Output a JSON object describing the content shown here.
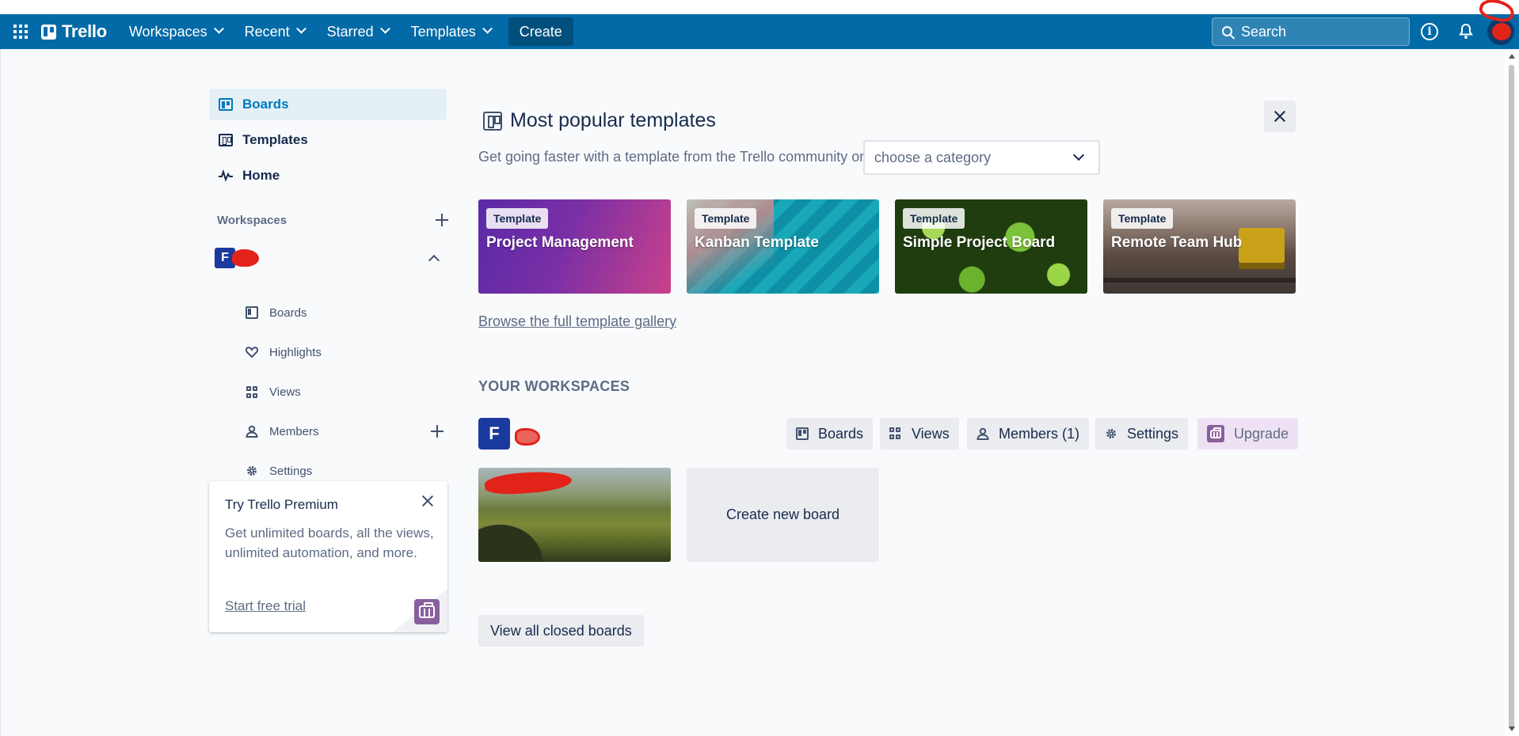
{
  "topbar": {
    "brand": "Trello",
    "nav": [
      {
        "label": "Workspaces"
      },
      {
        "label": "Recent"
      },
      {
        "label": "Starred"
      },
      {
        "label": "Templates"
      }
    ],
    "create_label": "Create",
    "search_placeholder": "Search",
    "info_glyph": "i",
    "accent": "#026aa7"
  },
  "sidebar": {
    "links": [
      {
        "label": "Boards",
        "icon": "board-icon",
        "active": true
      },
      {
        "label": "Templates",
        "icon": "template-icon"
      },
      {
        "label": "Home",
        "icon": "pulse-icon"
      }
    ],
    "workspaces_label": "Workspaces",
    "workspace_initial": "F",
    "sub_items": [
      {
        "label": "Boards",
        "icon": "board-icon"
      },
      {
        "label": "Highlights",
        "icon": "heart-icon"
      },
      {
        "label": "Views",
        "icon": "grid-icon"
      },
      {
        "label": "Members",
        "icon": "members-icon"
      },
      {
        "label": "Settings",
        "icon": "gear-icon"
      }
    ]
  },
  "premium": {
    "title": "Try Trello Premium",
    "body": "Get unlimited boards, all the views, unlimited automation, and more.",
    "link": "Start free trial"
  },
  "templates": {
    "heading": "Most popular templates",
    "subtitle": "Get going faster with a template from the Trello community or",
    "category_placeholder": "choose a category",
    "badge": "Template",
    "cards": [
      {
        "name": "Project Management"
      },
      {
        "name": "Kanban Template"
      },
      {
        "name": "Simple Project Board"
      },
      {
        "name": "Remote Team Hub"
      }
    ],
    "browse_link": "Browse the full template gallery"
  },
  "workspace_section": {
    "heading": "YOUR WORKSPACES",
    "initial": "F",
    "buttons": {
      "boards": "Boards",
      "views": "Views",
      "members": "Members (1)",
      "settings": "Settings",
      "upgrade": "Upgrade"
    },
    "create_board": "Create new board",
    "closed_boards": "View all closed boards"
  }
}
